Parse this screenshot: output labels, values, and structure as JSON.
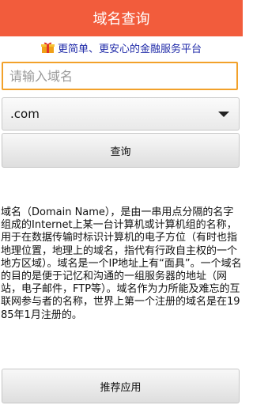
{
  "header": {
    "title": "域名查询"
  },
  "banner": {
    "icon": "gift-icon",
    "text": "更简单、更安心的金融服务平台"
  },
  "search": {
    "placeholder": "请输入域名",
    "value": ""
  },
  "suffix_select": {
    "selected": ".com"
  },
  "buttons": {
    "search_label": "查询",
    "recommend_label": "推荐应用"
  },
  "description": "域名（Domain Name），是由一串用点分隔的名字组成的Internet上某一台计算机或计算机组的名称，用于在数据传输时标识计算机的电子方位（有时也指地理位置，地理上的域名，指代有行政自主权的一个地方区域）。域名是一个IP地址上有“面具”。一个域名的目的是便于记忆和沟通的一组服务器的地址（网站，电子邮件，FTP等）。域名作为力所能及难忘的互联网参与者的名称，世界上第一个注册的域名是在1985年1月注册的。",
  "colors": {
    "titlebar": "#f25c3c",
    "banner_text": "#1f2aa8",
    "input_focus_border": "#f2a12a"
  }
}
